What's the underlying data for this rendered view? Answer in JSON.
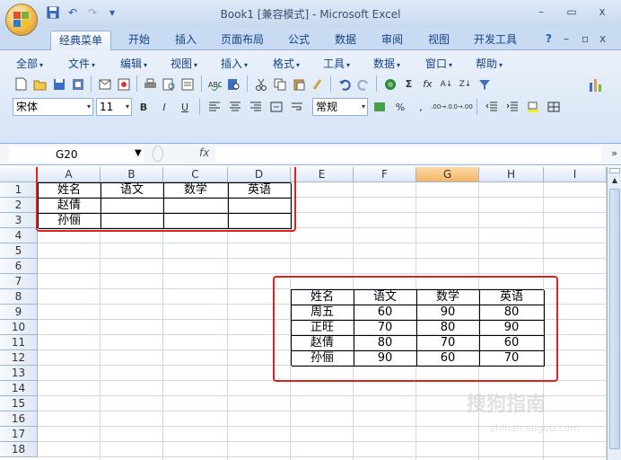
{
  "window": {
    "title": "Book1 [兼容模式] - Microsoft Excel",
    "minimize": "–",
    "maximize": "▭",
    "close": "x"
  },
  "qat": {
    "save": "▣",
    "undo": "↶",
    "redo": "↷",
    "customize": "▾"
  },
  "tabs": [
    {
      "label": "经典菜单"
    },
    {
      "label": "开始"
    },
    {
      "label": "插入"
    },
    {
      "label": "页面布局"
    },
    {
      "label": "公式"
    },
    {
      "label": "数据"
    },
    {
      "label": "审阅"
    },
    {
      "label": "视图"
    },
    {
      "label": "开发工具"
    }
  ],
  "tab_right": {
    "help": "?",
    "minimize": "–",
    "restore": "▫",
    "close": "x"
  },
  "menus": [
    {
      "label": "全部"
    },
    {
      "label": "文件"
    },
    {
      "label": "编辑"
    },
    {
      "label": "视图"
    },
    {
      "label": "插入"
    },
    {
      "label": "格式"
    },
    {
      "label": "工具"
    },
    {
      "label": "数据"
    },
    {
      "label": "窗口"
    },
    {
      "label": "帮助"
    }
  ],
  "format": {
    "font": "宋体",
    "size": "11",
    "bold": "B",
    "italic": "I",
    "underline": "U",
    "numformat": "常规",
    "percent": "%",
    "comma": ",",
    "inc_dec": ".00→.0",
    "dec_dec": ".0→.00"
  },
  "formula_bar": {
    "namebox": "G20",
    "fx": "fx"
  },
  "columns": [
    "A",
    "B",
    "C",
    "D",
    "E",
    "F",
    "G",
    "H",
    "I"
  ],
  "rows": [
    "1",
    "2",
    "3",
    "4",
    "5",
    "6",
    "7",
    "8",
    "9",
    "10",
    "11",
    "12",
    "13",
    "14",
    "15",
    "16",
    "17",
    "18"
  ],
  "table1": {
    "header": [
      "姓名",
      "语文",
      "数学",
      "英语"
    ],
    "names": [
      "赵倩",
      "孙俪"
    ]
  },
  "table2": {
    "header": [
      "姓名",
      "语文",
      "数学",
      "英语"
    ],
    "rows": [
      [
        "周五",
        "60",
        "90",
        "80"
      ],
      [
        "正旺",
        "70",
        "80",
        "90"
      ],
      [
        "赵倩",
        "80",
        "70",
        "60"
      ],
      [
        "孙俪",
        "90",
        "60",
        "70"
      ]
    ]
  },
  "watermark": "搜狗指南",
  "watermark_url": "zhinan.sogou.com",
  "colors": {
    "red_box": "#e0221b",
    "selected_col": "#f4b56a",
    "ribbon": "#d6e4f5"
  }
}
